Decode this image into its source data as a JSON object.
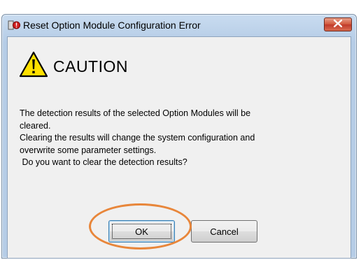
{
  "dialog": {
    "title": "Reset Option Module Configuration Error",
    "close_icon": "close-icon",
    "app_icon": "error-app-icon"
  },
  "content": {
    "warning_icon": "warning-triangle-icon",
    "heading": "CAUTION",
    "message_lines": [
      "The detection results of the selected Option Modules will be",
      "cleared.",
      "Clearing the results will change the system configuration and",
      "overwrite some parameter settings.",
      " Do you want to clear the detection results?"
    ]
  },
  "buttons": {
    "ok_label": "OK",
    "cancel_label": "Cancel"
  },
  "colors": {
    "highlight_ring": "#e8863a",
    "close_button": "#c0392b",
    "client_background": "#f0f0f0"
  }
}
